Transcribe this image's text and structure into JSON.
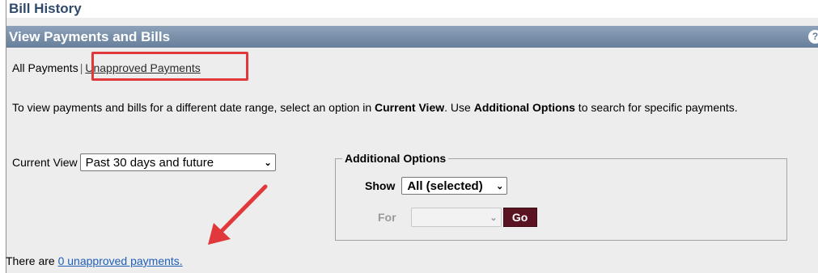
{
  "page": {
    "title": "Bill History",
    "section_title": "View Payments and Bills",
    "help_icon": "?"
  },
  "tabs": {
    "active": "All Payments",
    "separator": "|",
    "link": "Unapproved Payments"
  },
  "instructions": {
    "part1": "To view payments and bills for a different date range, select an option in ",
    "bold1": "Current View",
    "part2": ". Use ",
    "bold2": "Additional Options",
    "part3": " to search for specific payments."
  },
  "current_view": {
    "label": "Current View",
    "selected": "Past 30 days and future"
  },
  "additional_options": {
    "legend": "Additional Options",
    "show_label": "Show",
    "show_selected": "All (selected)",
    "for_label": "For",
    "for_selected": "",
    "go_label": "Go"
  },
  "footer": {
    "prefix": "There are ",
    "link": "0 unapproved payments."
  },
  "colors": {
    "header_bg": "#7890ab",
    "highlight": "#e0383b",
    "go_button": "#5a1421",
    "link": "#1f5fb8"
  }
}
